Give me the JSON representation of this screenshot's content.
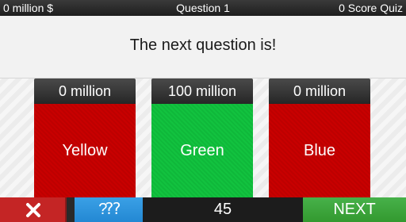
{
  "topbar": {
    "money": "0 million $",
    "question_label": "Question 1",
    "score": "0 Score Quiz"
  },
  "question": {
    "text": "The next question is!"
  },
  "options": [
    {
      "amount": "0 million",
      "label": "Yellow",
      "color": "#c80000"
    },
    {
      "amount": "100 million",
      "label": "Green",
      "color": "#12c23f"
    },
    {
      "amount": "0 million",
      "label": "Blue",
      "color": "#c80000"
    }
  ],
  "bottombar": {
    "close_icon": "close-icon",
    "hint_icon": "question-marks-icon",
    "timer": "45",
    "next_label": "NEXT"
  }
}
